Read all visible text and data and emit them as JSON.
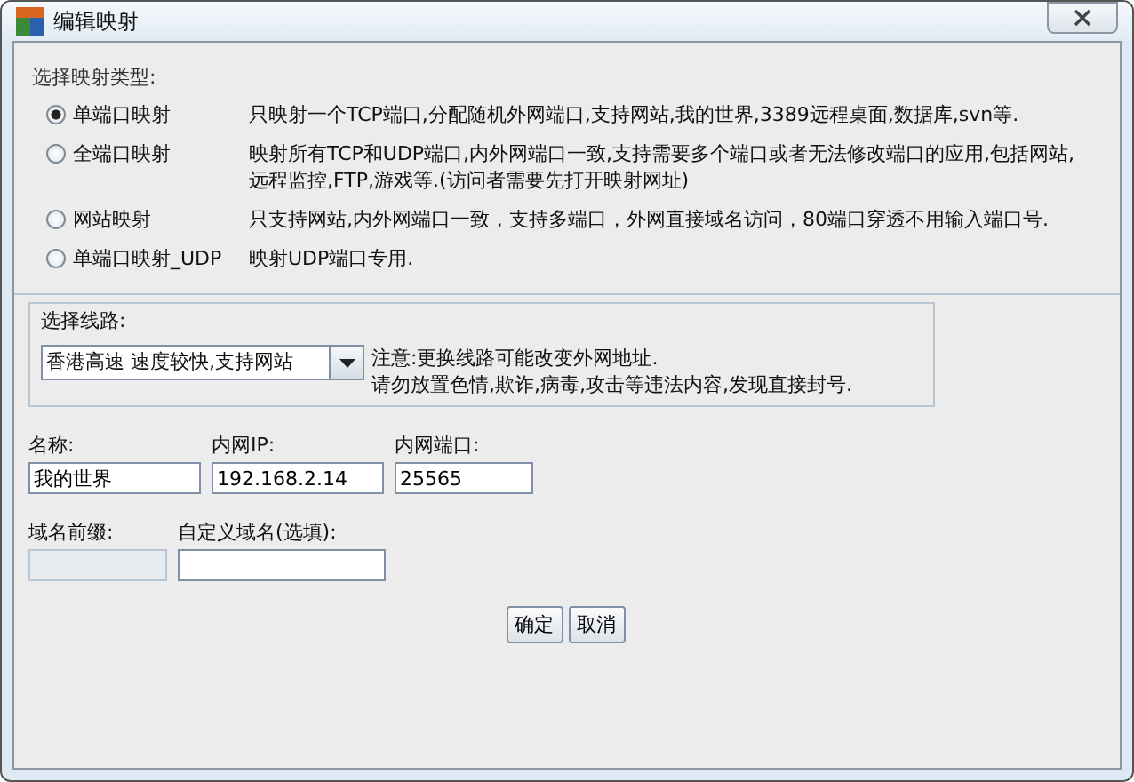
{
  "window": {
    "title": "编辑映射"
  },
  "mapping_type": {
    "label": "选择映射类型:",
    "options": [
      {
        "label": "单端口映射",
        "description": "只映射一个TCP端口,分配随机外网端口,支持网站,我的世界,3389远程桌面,数据库,svn等.",
        "selected": true
      },
      {
        "label": "全端口映射",
        "description": "映射所有TCP和UDP端口,内外网端口一致,支持需要多个端口或者无法修改端口的应用,包括网站,远程监控,FTP,游戏等.(访问者需要先打开映射网址)",
        "selected": false
      },
      {
        "label": "网站映射",
        "description": "只支持网站,内外网端口一致，支持多端口，外网直接域名访问，80端口穿透不用输入端口号.",
        "selected": false
      },
      {
        "label": "单端口映射_UDP",
        "description": "映射UDP端口专用.",
        "selected": false
      }
    ]
  },
  "route": {
    "label": "选择线路:",
    "combo": {
      "value": "香港高速  速度较快,支持网站"
    },
    "notes": [
      "注意:更换线路可能改变外网地址.",
      "请勿放置色情,欺诈,病毒,攻击等违法内容,发现直接封号."
    ]
  },
  "field_rows": [
    [
      {
        "label": "名称:",
        "value": "我的世界",
        "disabled": false
      },
      {
        "label": "内网IP:",
        "value": "192.168.2.14",
        "disabled": false
      },
      {
        "label": "内网端口:",
        "value": "25565",
        "disabled": false
      }
    ],
    [
      {
        "label": "域名前缀:",
        "disabled": true
      },
      {
        "label": "自定义域名(选填):",
        "disabled": false
      }
    ]
  ],
  "buttons": [
    "确定",
    "取消"
  ]
}
